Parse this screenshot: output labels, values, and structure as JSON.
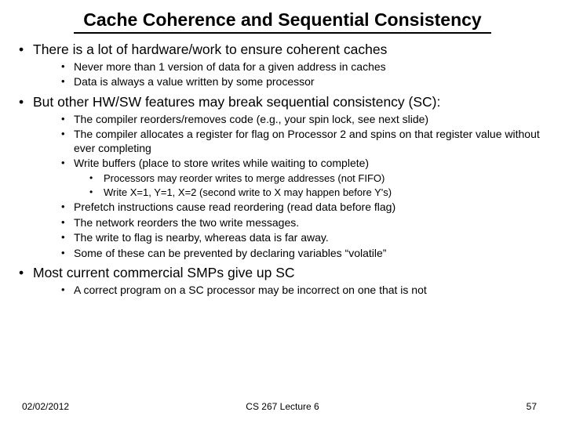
{
  "title": "Cache Coherence and Sequential Consistency",
  "bullets": {
    "b1": "There is a lot of hardware/work to ensure coherent caches",
    "b1a": "Never more than 1 version of data for a given address in caches",
    "b1b": "Data is always a value written by some processor",
    "b2": "But other HW/SW features may break sequential consistency (SC):",
    "b2a": "The compiler reorders/removes code (e.g., your spin lock, see next slide)",
    "b2b": "The compiler allocates a register for flag on Processor 2 and spins on that register value without ever completing",
    "b2c": "Write buffers (place to store writes while waiting to complete)",
    "b2c1": "Processors may reorder writes to merge addresses (not FIFO)",
    "b2c2": "Write X=1, Y=1, X=2 (second write to X may happen before Y's)",
    "b2d": "Prefetch instructions cause read reordering (read data before flag)",
    "b2e": "The network reorders the two write messages.",
    "b2f": " The write to flag is nearby, whereas data is far away.",
    "b2g": "Some of these can be prevented by declaring variables “volatile”",
    "b3": "Most current commercial SMPs give up SC",
    "b3a": "A correct program on a SC processor may be incorrect on one that is not"
  },
  "footer": {
    "date": "02/02/2012",
    "center": "CS 267 Lecture 6",
    "page": "57"
  }
}
